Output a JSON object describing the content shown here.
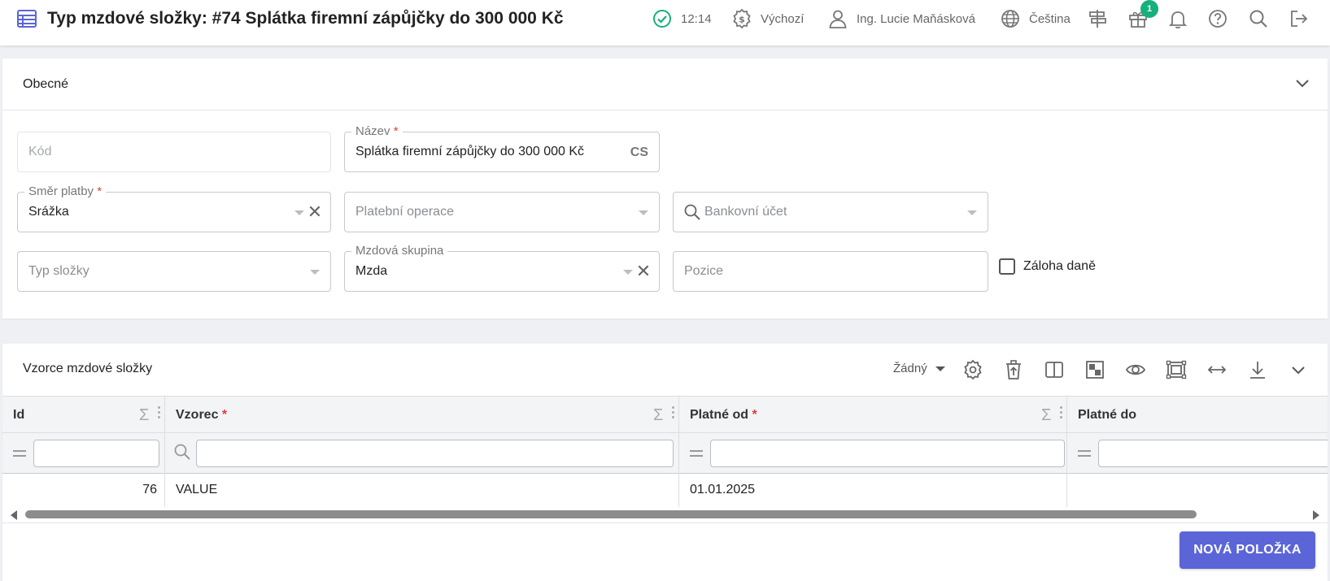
{
  "header": {
    "title": "Typ mzdové složky: #74 Splátka firemní zápůjčky do 300 000 Kč",
    "time": "12:14",
    "currency_profile": "Výchozí",
    "user": "Ing. Lucie Maňásková",
    "language": "Čeština",
    "gift_badge": "1",
    "colors": {
      "status_ok": "#16b07a",
      "badge": "#16b07a"
    }
  },
  "general": {
    "title": "Obecné",
    "code": {
      "placeholder": "Kód"
    },
    "name": {
      "label": "Název",
      "value": "Splátka firemní zápůjčky do 300 000 Kč",
      "lang": "CS"
    },
    "payment_direction": {
      "label": "Směr platby",
      "value": "Srážka"
    },
    "payment_operation": {
      "placeholder": "Platební operace"
    },
    "bank_account": {
      "placeholder": "Bankovní účet"
    },
    "component_type": {
      "placeholder": "Typ složky"
    },
    "wage_group": {
      "label": "Mzdová skupina",
      "value": "Mzda"
    },
    "position": {
      "placeholder": "Pozice"
    },
    "tax_advance": {
      "label": "Záloha daně",
      "checked": false
    }
  },
  "formulas": {
    "title": "Vzorce mzdové složky",
    "view_select": "Žádný",
    "columns": [
      {
        "label": "Id",
        "required": false
      },
      {
        "label": "Vzorec",
        "required": true
      },
      {
        "label": "Platné od",
        "required": true
      },
      {
        "label": "Platné do",
        "required": false
      }
    ],
    "rows": [
      {
        "id": "76",
        "formula": "VALUE",
        "valid_from": "01.01.2025",
        "valid_to": ""
      }
    ],
    "new_item_label": "NOVÁ POLOŽKA",
    "colors": {
      "primary": "#5b65d8"
    }
  }
}
